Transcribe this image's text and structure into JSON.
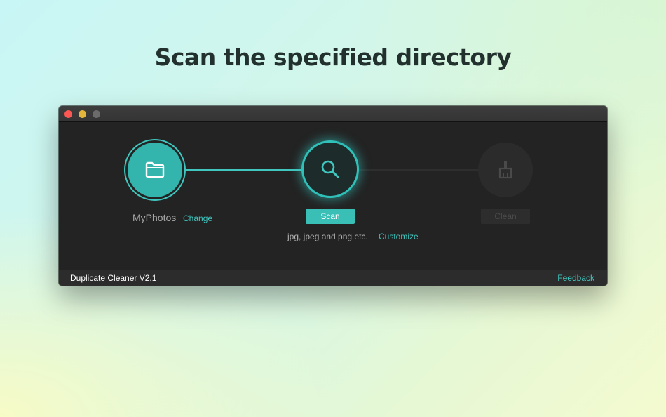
{
  "headline": "Scan the specified directory",
  "window": {
    "traffic_lights": [
      "close",
      "minimize",
      "maximize"
    ]
  },
  "steps": {
    "source": {
      "icon": "folder-icon",
      "label": "MyPhotos",
      "action_link": "Change"
    },
    "scan": {
      "icon": "search-icon",
      "button_label": "Scan",
      "file_types": "jpg, jpeg and png etc.",
      "action_link": "Customize"
    },
    "clean": {
      "icon": "broom-icon",
      "button_label": "Clean",
      "enabled": false
    }
  },
  "statusbar": {
    "app_version": "Duplicate Cleaner V2.1",
    "feedback_link": "Feedback"
  },
  "colors": {
    "accent": "#3fc6bf",
    "window_bg": "#232323",
    "headline": "#22302e"
  }
}
